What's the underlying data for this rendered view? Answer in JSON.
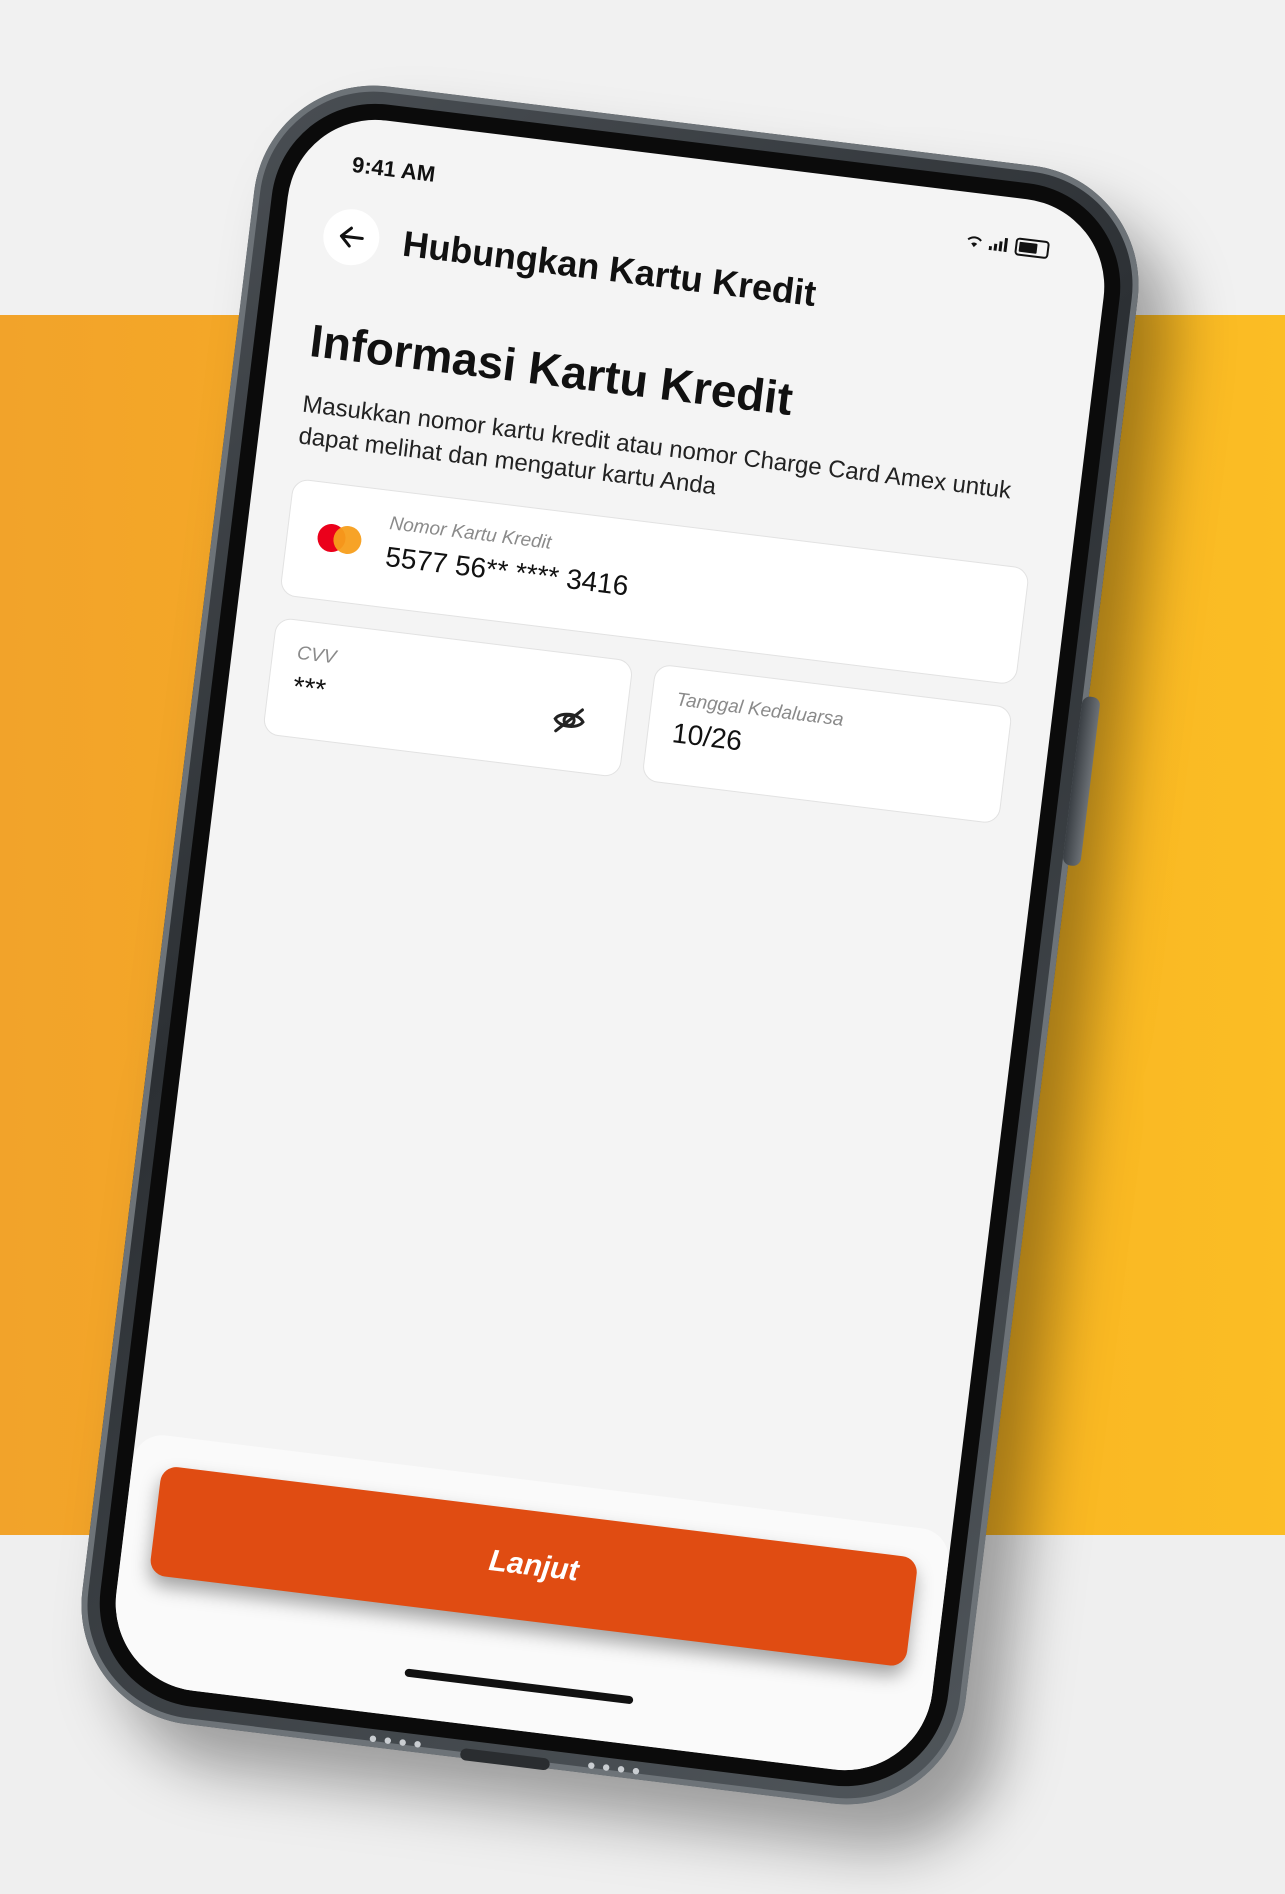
{
  "status_bar": {
    "time": "9:41 AM",
    "signal_icon": "signal-icon",
    "wifi_icon": "wifi-icon",
    "battery_icon": "battery-icon"
  },
  "header": {
    "back_icon": "back-arrow-icon",
    "title": "Hubungkan Kartu Kredit"
  },
  "section": {
    "title": "Informasi Kartu Kredit",
    "description": "Masukkan nomor kartu kredit atau nomor Charge Card Amex untuk dapat melihat dan mengatur kartu Anda"
  },
  "fields": {
    "card_number": {
      "label": "Nomor Kartu Kredit",
      "value": "5577 56** **** 3416",
      "brand_icon": "mastercard-logo"
    },
    "cvv": {
      "label": "CVV",
      "value": "***",
      "toggle_icon": "eye-off-icon"
    },
    "expiry": {
      "label": "Tanggal Kedaluarsa",
      "value": "10/26"
    }
  },
  "footer": {
    "cta_label": "Lanjut"
  },
  "colors": {
    "band_left": "#f2a32a",
    "band_right": "#fbbd24",
    "cta": "#e04c12",
    "mastercard_red": "#eb001b",
    "mastercard_orange": "#f79e1b"
  }
}
